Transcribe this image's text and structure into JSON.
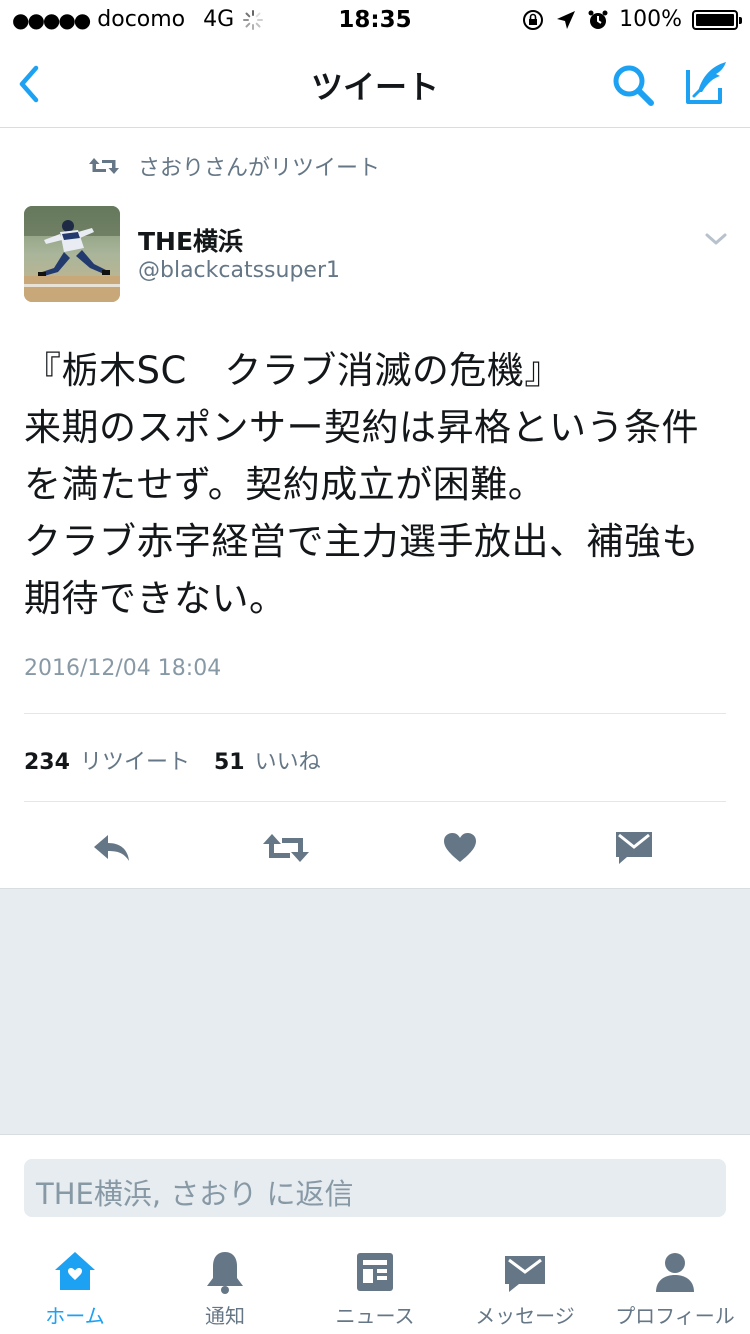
{
  "status_bar": {
    "carrier": "docomo",
    "network": "4G",
    "time": "18:35",
    "battery": "100%"
  },
  "nav": {
    "title": "ツイート"
  },
  "retweet_context": "さおりさんがリツイート",
  "tweet": {
    "author_name": "THE横浜",
    "author_handle": "@blackcatssuper1",
    "text": "『栃木SC　クラブ消滅の危機』\n来期のスポンサー契約は昇格という条件を満たせず。契約成立が困難。\nクラブ赤字経営で主力選手放出、補強も期待できない。",
    "timestamp": "2016/12/04 18:04",
    "retweet_count": "234",
    "retweet_label": "リツイート",
    "like_count": "51",
    "like_label": "いいね"
  },
  "reply": {
    "placeholder": "THE横浜, さおり に返信"
  },
  "tabbar": {
    "items": [
      {
        "label": "ホーム",
        "icon": "home-icon",
        "active": true
      },
      {
        "label": "通知",
        "icon": "bell-icon"
      },
      {
        "label": "ニュース",
        "icon": "news-icon"
      },
      {
        "label": "メッセージ",
        "icon": "envelope-icon"
      },
      {
        "label": "プロフィール",
        "icon": "profile-icon"
      }
    ]
  },
  "colors": {
    "accent": "#1da1f2",
    "icon_grey": "#657786",
    "background_grey": "#e6ecf0"
  }
}
